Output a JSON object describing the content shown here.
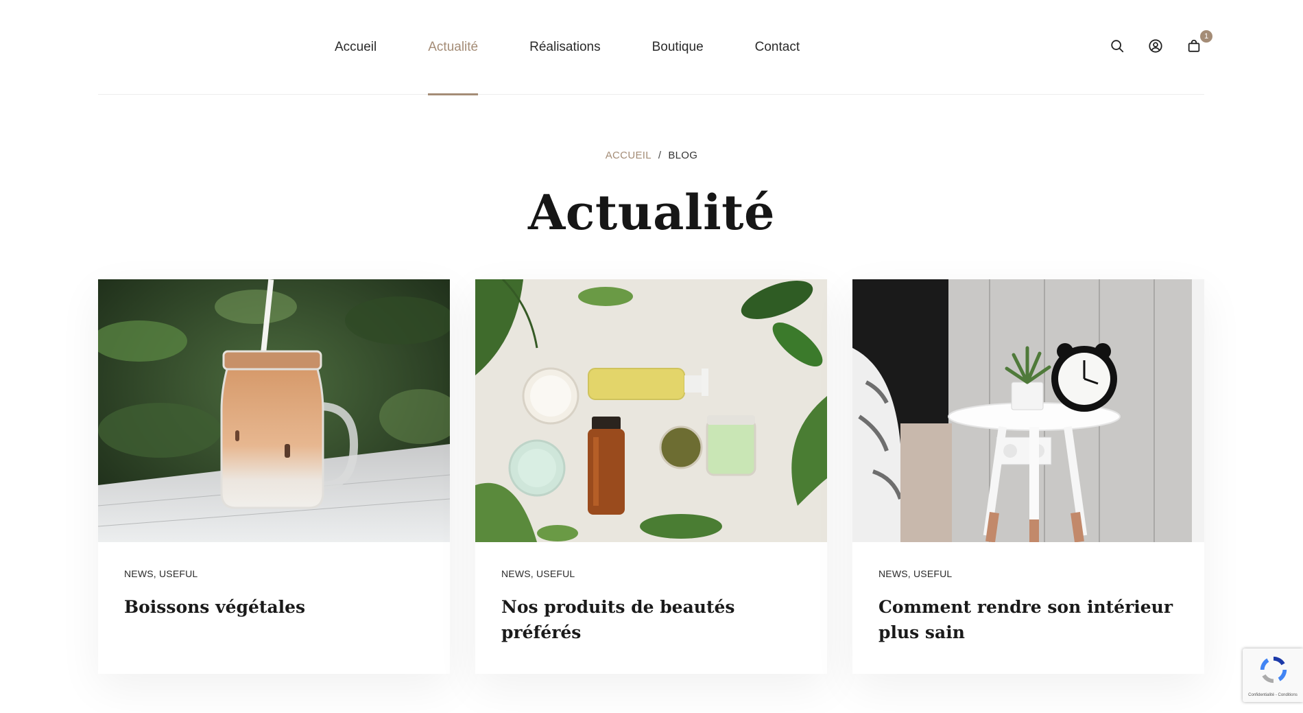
{
  "nav": {
    "items": [
      {
        "label": "Accueil"
      },
      {
        "label": "Actualité"
      },
      {
        "label": "Réalisations"
      },
      {
        "label": "Boutique"
      },
      {
        "label": "Contact"
      }
    ],
    "active": "Actualité"
  },
  "header_icons": {
    "search": "search-icon",
    "account": "user-icon",
    "cart": "cart-icon",
    "cart_count": "1"
  },
  "breadcrumb": {
    "home": "ACCUEIL",
    "separator": "/",
    "current": "BLOG"
  },
  "page": {
    "title": "Actualité"
  },
  "posts": [
    {
      "categories": "NEWS, USEFUL",
      "title": "Boissons végétales"
    },
    {
      "categories": "NEWS, USEFUL",
      "title": "Nos produits de beautés préférés"
    },
    {
      "categories": "NEWS, USEFUL",
      "title": "Comment rendre son intérieur plus sain"
    }
  ],
  "recaptcha": {
    "text": "Confidentialité - Conditions"
  },
  "colors": {
    "accent": "#a48c76",
    "text": "#1a1a1a",
    "divider": "#ececec"
  }
}
